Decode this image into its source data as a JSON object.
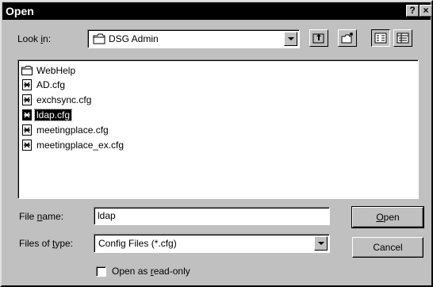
{
  "dialog": {
    "title": "Open",
    "help_glyph": "?",
    "close_glyph": "×"
  },
  "look_in": {
    "label_pre": "Look ",
    "label_accel": "i",
    "label_post": "n:",
    "value": "DSG Admin"
  },
  "toolbar": {
    "icons": [
      "up-one-level-icon",
      "create-new-folder-icon",
      "list-view-icon",
      "details-view-icon"
    ]
  },
  "files": [
    {
      "name": "WebHelp",
      "type": "folder",
      "selected": false
    },
    {
      "name": "AD.cfg",
      "type": "cfg",
      "selected": false
    },
    {
      "name": "exchsync.cfg",
      "type": "cfg",
      "selected": false
    },
    {
      "name": "ldap.cfg",
      "type": "cfg",
      "selected": true
    },
    {
      "name": "meetingplace.cfg",
      "type": "cfg",
      "selected": false
    },
    {
      "name": "meetingplace_ex.cfg",
      "type": "cfg",
      "selected": false
    }
  ],
  "file_name": {
    "label_pre": "File ",
    "label_accel": "n",
    "label_post": "ame:",
    "value": "ldap"
  },
  "file_type": {
    "label_pre": "Files of ",
    "label_accel": "t",
    "label_post": "ype:",
    "value": "Config Files (*.cfg)"
  },
  "buttons": {
    "open_accel": "O",
    "open_rest": "pen",
    "cancel": "Cancel"
  },
  "readonly": {
    "label_pre": "Open as ",
    "label_accel": "r",
    "label_post": "ead-only",
    "checked": false
  }
}
